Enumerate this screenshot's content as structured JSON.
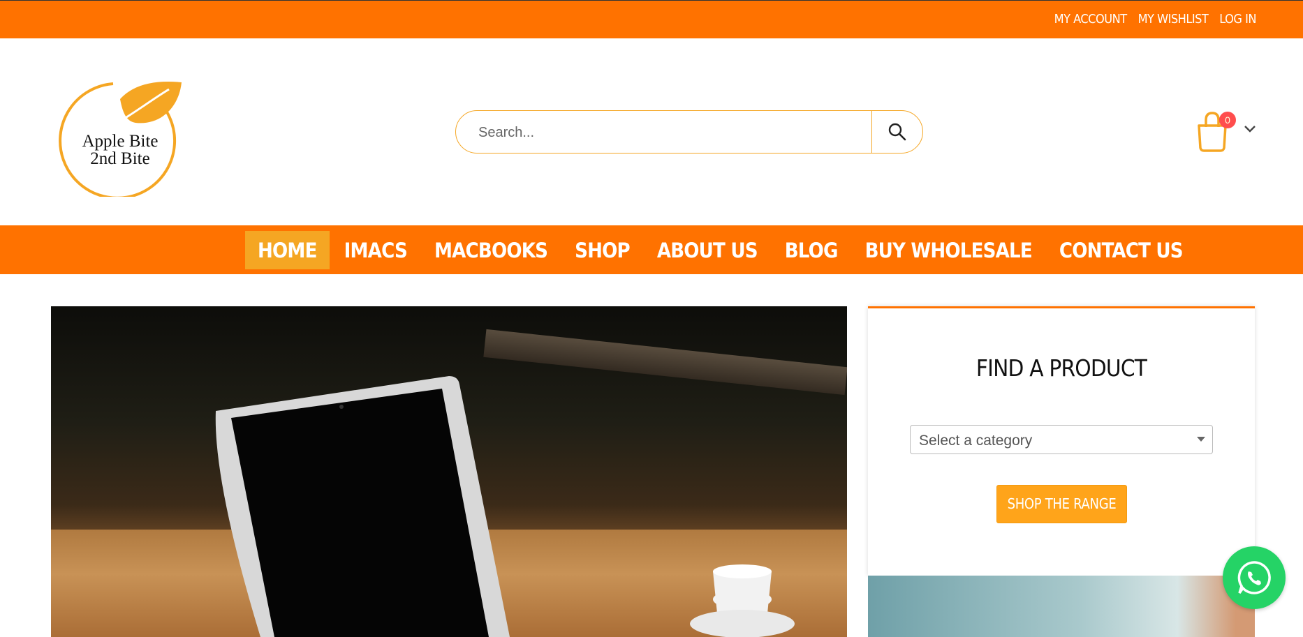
{
  "topbar": {
    "links": [
      "MY ACCOUNT",
      "MY WISHLIST",
      "LOG IN"
    ]
  },
  "header": {
    "logo_line1": "Apple Bite",
    "logo_line2": "2nd Bite",
    "search_placeholder": "Search...",
    "cart_count": "0"
  },
  "nav": {
    "items": [
      "HOME",
      "IMACS",
      "MACBOOKS",
      "SHOP",
      "ABOUT US",
      "BLOG",
      "BUY WHOLESALE",
      "CONTACT US"
    ],
    "active": "HOME"
  },
  "sidebar": {
    "title": "FIND A PRODUCT",
    "select_value": "Select a category",
    "button_label": "SHOP THE RANGE"
  },
  "colors": {
    "brand_orange": "#ff7200",
    "accent_yellow": "#f5a623",
    "whatsapp_green": "#25d366"
  },
  "icons": [
    "search-icon",
    "cart-icon",
    "chevron-down-icon",
    "whatsapp-icon",
    "leaf-logo-icon"
  ]
}
